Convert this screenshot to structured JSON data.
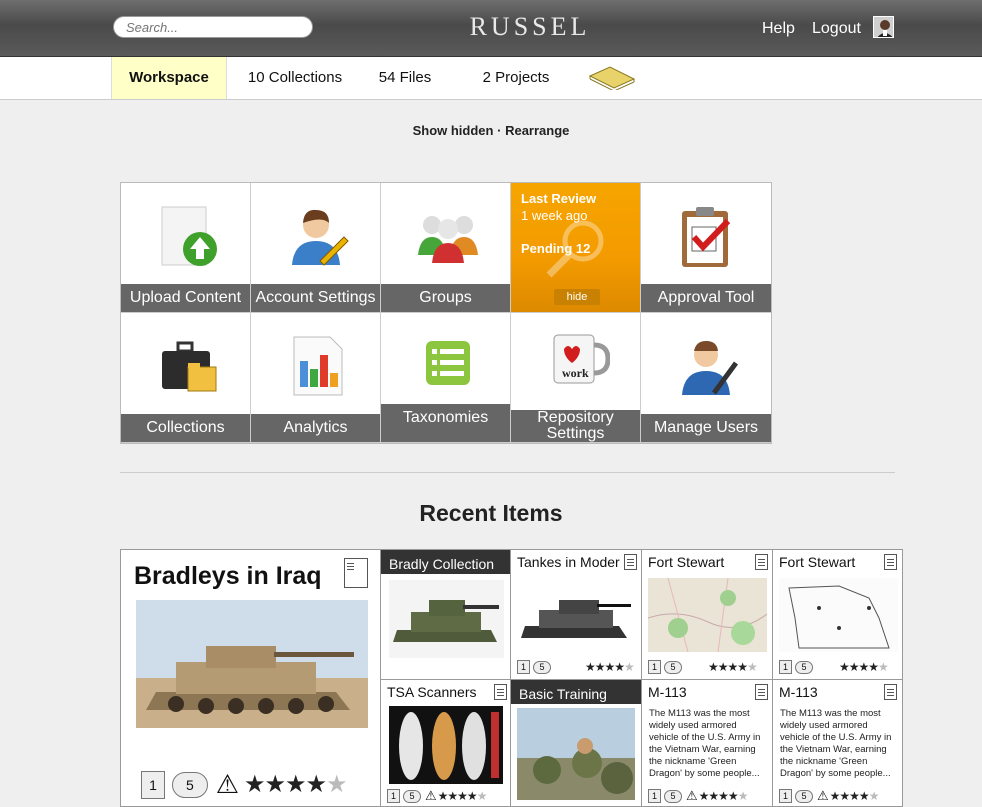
{
  "header": {
    "search_placeholder": "Search...",
    "logo": "RUSSEL",
    "help": "Help",
    "logout": "Logout"
  },
  "nav": {
    "workspace": "Workspace",
    "collections": "10 Collections",
    "files": "54 Files",
    "projects": "2 Projects"
  },
  "options": {
    "show_hidden": "Show hidden",
    "separator": "·",
    "rearrange": "Rearrange"
  },
  "tiles": {
    "upload": "Upload Content",
    "account": "Account Settings",
    "groups": "Groups",
    "approval": "Approval Tool",
    "collections": "Collections",
    "analytics": "Analytics",
    "taxonomies": "Taxonomies",
    "repository": "Repository Settings",
    "manage_users": "Manage Users",
    "review": {
      "title": "Last Review",
      "when": "1 week ago",
      "pending": "Pending 12",
      "hide": "hide"
    }
  },
  "recent": {
    "heading": "Recent Items",
    "big": {
      "title": "Bradleys in Iraq",
      "badge": "1",
      "comments": "5",
      "rating": 4
    },
    "items": [
      {
        "title": "Bradly Collection"
      },
      {
        "title": "Tankes in Moder",
        "badge": "1",
        "comments": "5",
        "rating": 4
      },
      {
        "title": "Fort Stewart",
        "badge": "1",
        "comments": "5",
        "rating": 4
      },
      {
        "title": "Fort Stewart",
        "badge": "1",
        "comments": "5",
        "rating": 4
      },
      {
        "title": "TSA Scanners",
        "badge": "1",
        "comments": "5",
        "rating": 4
      },
      {
        "title": "Basic Training"
      },
      {
        "title": "M-113",
        "desc": "The M113 was the most widely used armored vehicle of the U.S. Army in the Vietnam War, earning the nickname 'Green Dragon' by some people...",
        "badge": "1",
        "comments": "5",
        "rating": 4
      },
      {
        "title": "M-113",
        "desc": "The M113 was the most widely used armored vehicle of the U.S. Army in the Vietnam War, earning the nickname 'Green Dragon' by some people...",
        "badge": "1",
        "comments": "5",
        "rating": 4
      }
    ]
  },
  "colors": {
    "accent": "#f59f00",
    "active_tab": "#ffffc8",
    "tile_label": "#666666"
  }
}
